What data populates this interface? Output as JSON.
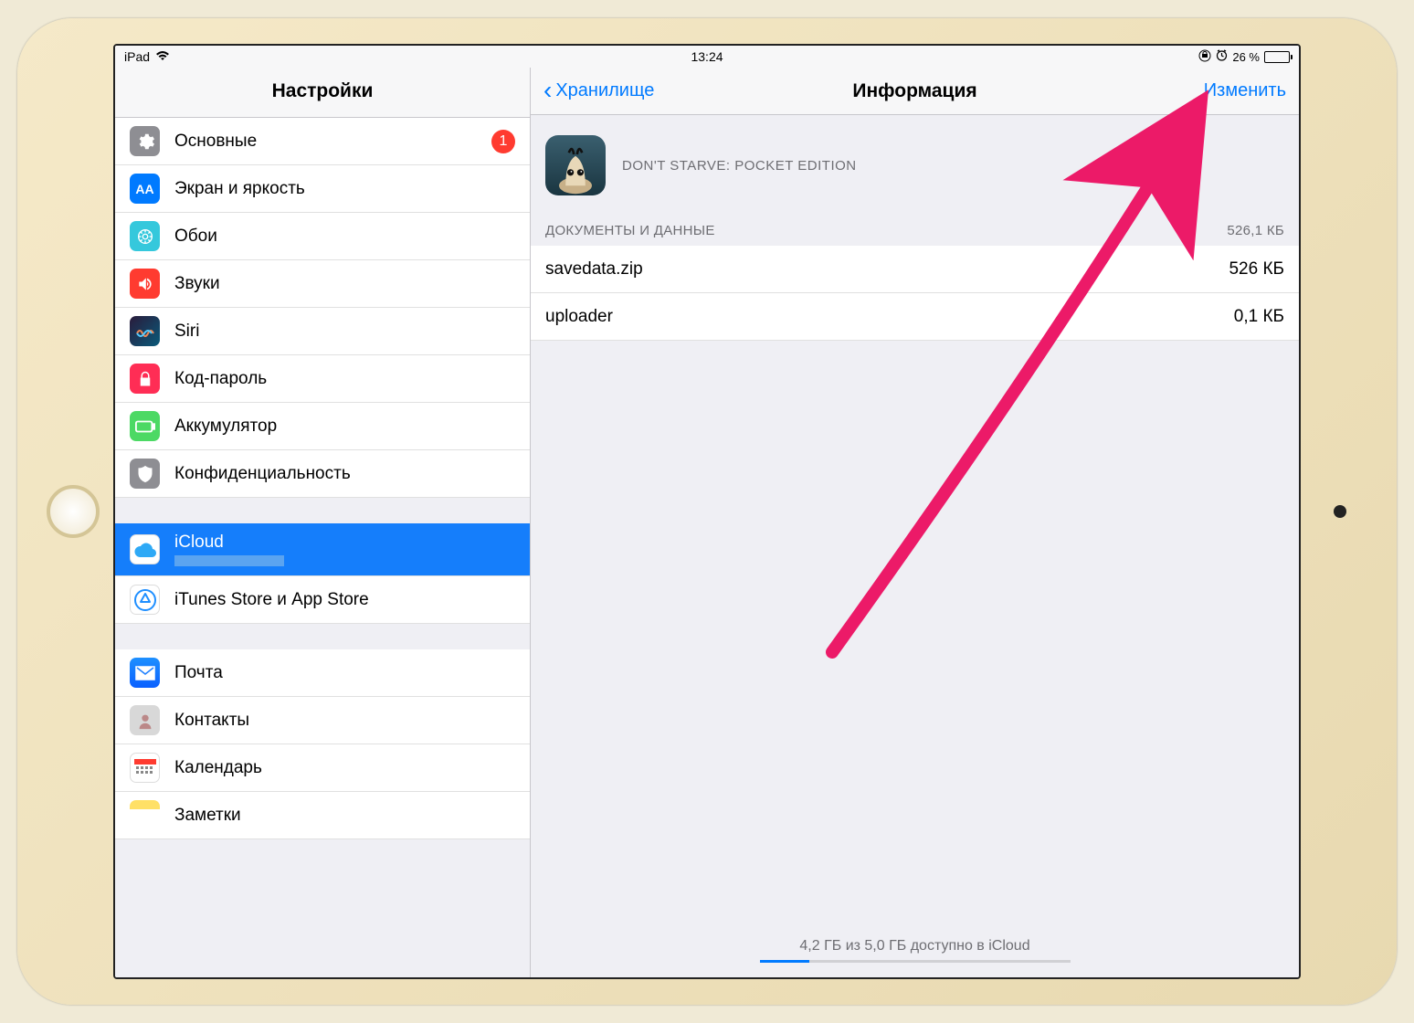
{
  "status": {
    "device": "iPad",
    "time": "13:24",
    "battery_pct": "26 %"
  },
  "sidebar": {
    "title": "Настройки",
    "badge": "1",
    "items": {
      "general": "Основные",
      "display": "Экран и яркость",
      "wallpaper": "Обои",
      "sounds": "Звуки",
      "siri": "Siri",
      "passcode": "Код-пароль",
      "battery": "Аккумулятор",
      "privacy": "Конфиденциальность",
      "icloud": "iCloud",
      "icloud_sub": "",
      "store": "iTunes Store и App Store",
      "mail": "Почта",
      "contacts": "Контакты",
      "calendar": "Календарь",
      "notes": "Заметки"
    }
  },
  "detail": {
    "back": "Хранилище",
    "title": "Информация",
    "edit": "Изменить",
    "app_name": "DON'T STARVE: POCKET EDITION",
    "section_header": "ДОКУМЕНТЫ И ДАННЫЕ",
    "section_size": "526,1 КБ",
    "rows": [
      {
        "name": "savedata.zip",
        "size": "526 КБ"
      },
      {
        "name": "uploader",
        "size": "0,1 КБ"
      }
    ],
    "footer": "4,2 ГБ из 5,0 ГБ доступно в iCloud"
  }
}
